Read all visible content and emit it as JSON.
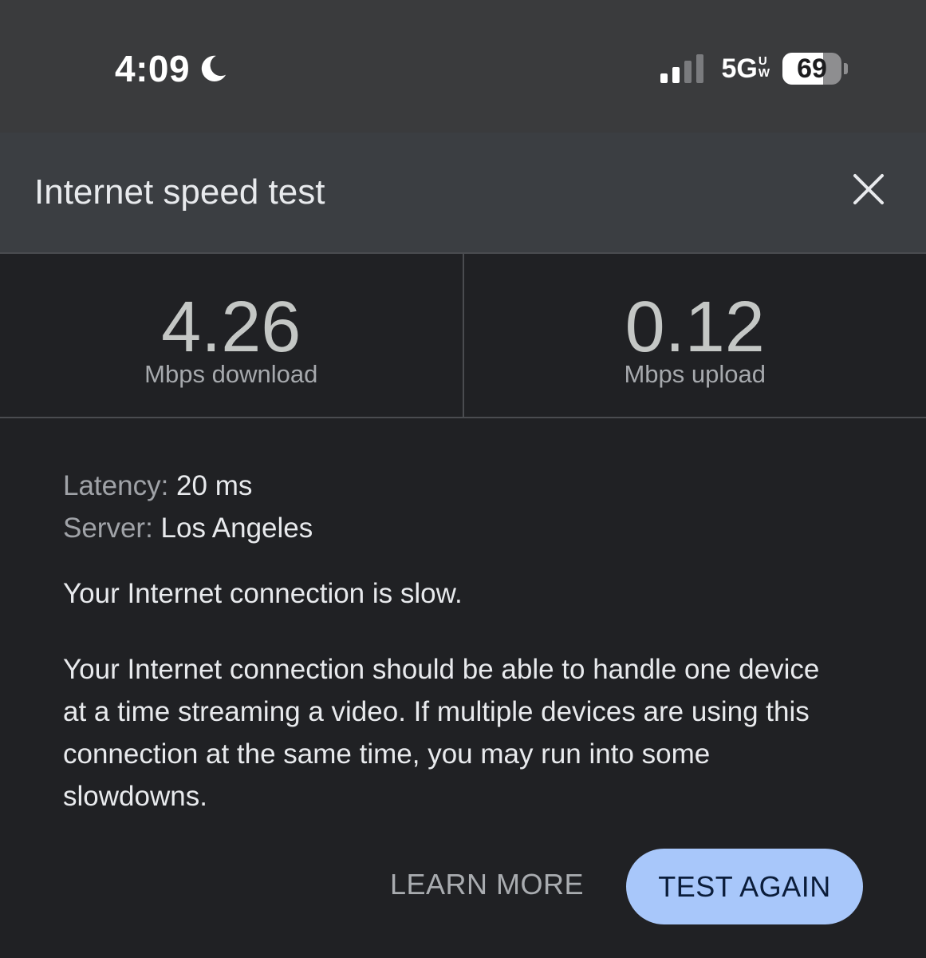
{
  "status_bar": {
    "time": "4:09",
    "focus_icon": "moon-icon",
    "signal_icon": "cellular-signal-icon",
    "network": "5G",
    "network_sup_top": "U",
    "network_sup_bottom": "W",
    "battery_percent": "69",
    "battery_level": 0.69
  },
  "dialog": {
    "title": "Internet speed test",
    "close_icon": "close-icon"
  },
  "results": {
    "download": {
      "value": "4.26",
      "label": "Mbps download"
    },
    "upload": {
      "value": "0.12",
      "label": "Mbps upload"
    }
  },
  "details": {
    "latency_label": "Latency:",
    "latency_value": "20 ms",
    "server_label": "Server:",
    "server_value": "Los Angeles"
  },
  "summary": "Your Internet connection is slow.",
  "description": "Your Internet connection should be able to handle one device at a time streaming a video. If multiple devices are using this connection at the same time, you may run into some slowdowns.",
  "actions": {
    "learn_more": "LEARN MORE",
    "test_again": "TEST AGAIN"
  },
  "colors": {
    "background": "#202124",
    "header": "#3b3e42",
    "status_bar": "#3a3b3d",
    "primary_button": "#a8c7fa"
  }
}
